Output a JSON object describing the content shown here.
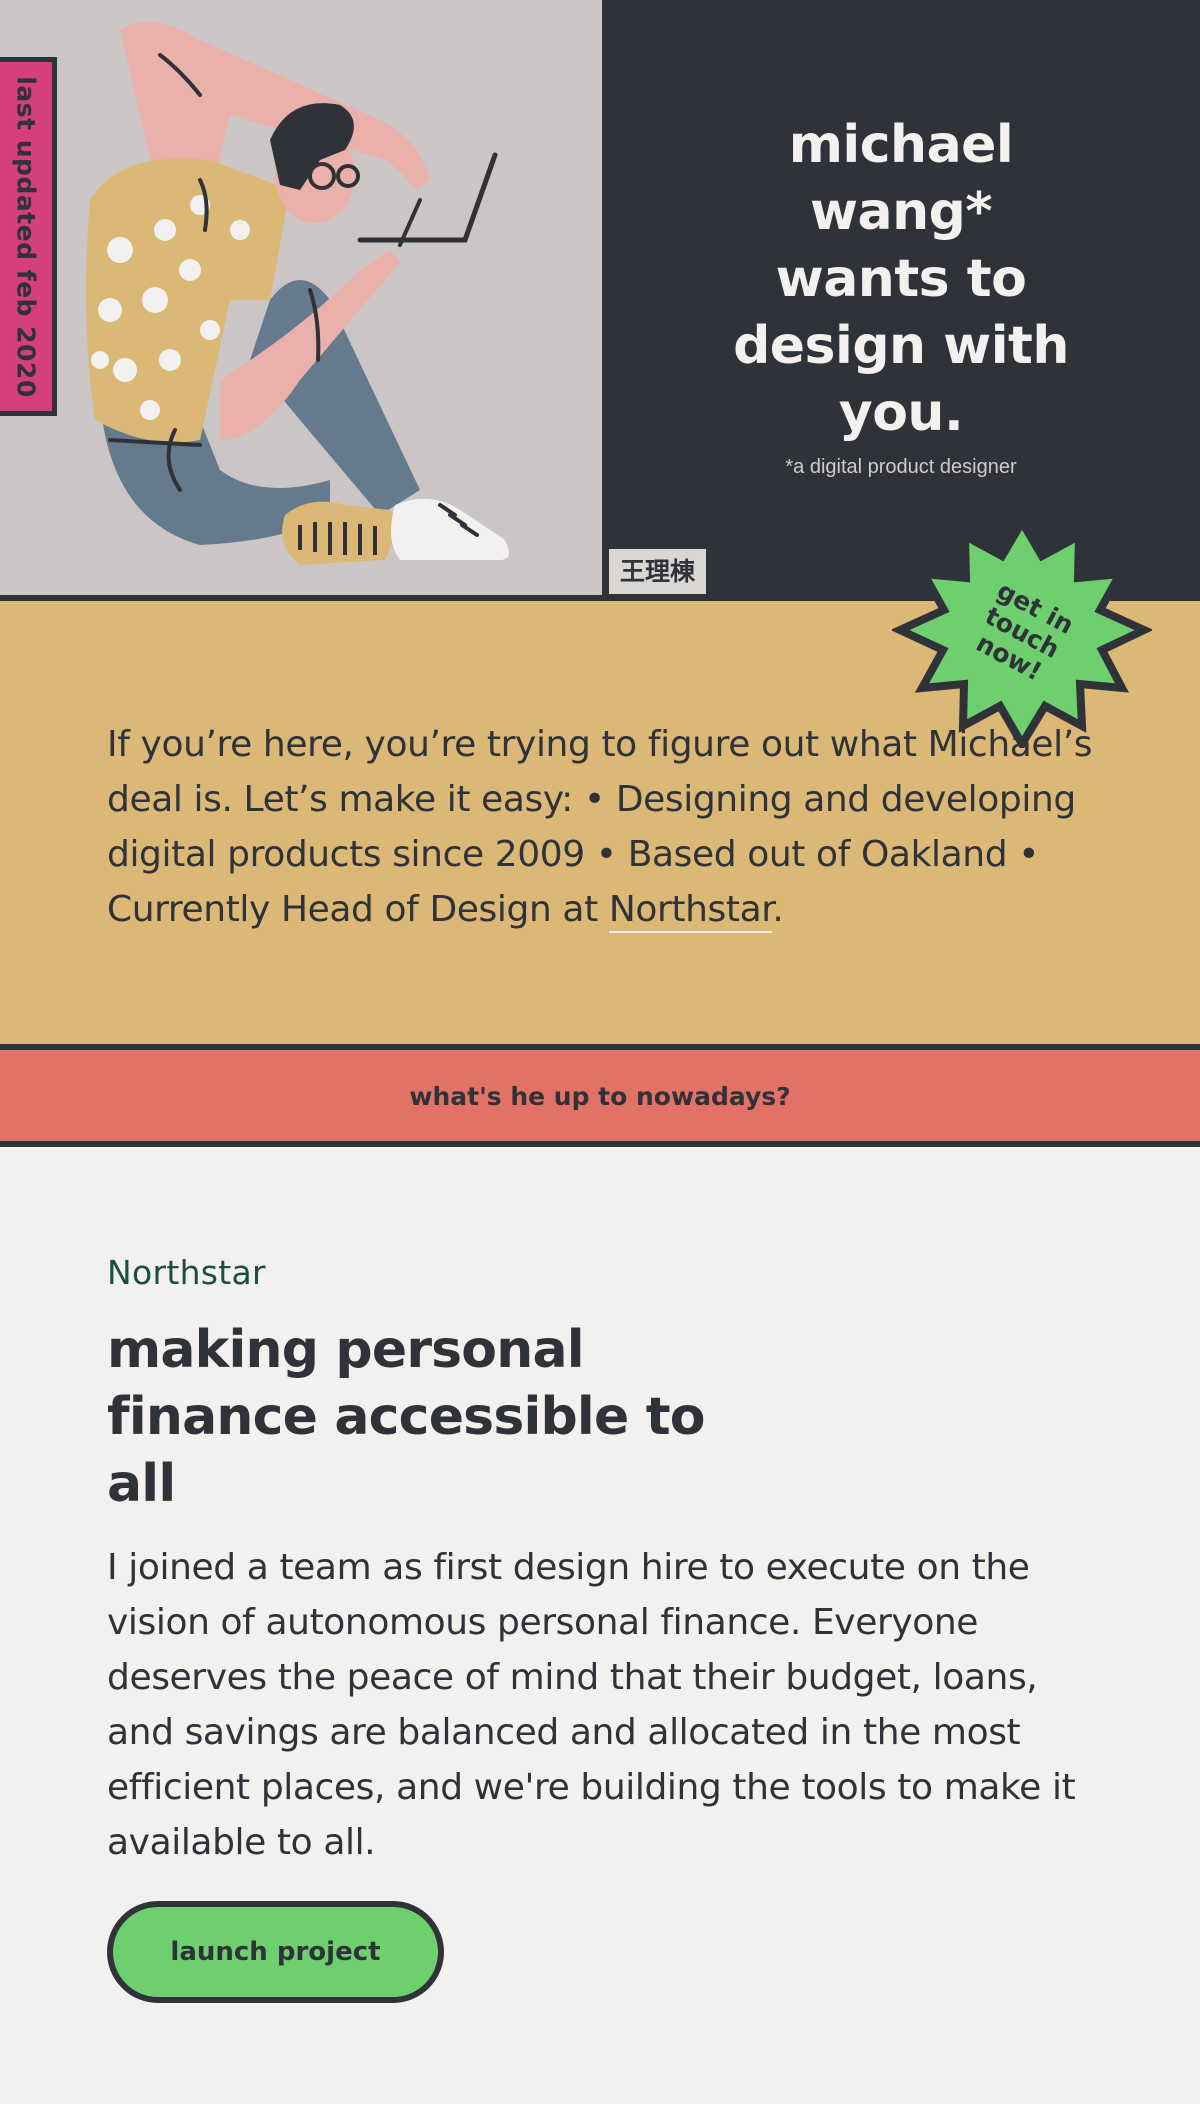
{
  "hero": {
    "updated_badge": "last updated feb 2020",
    "title_lines": [
      "michael",
      "wang*",
      "wants to",
      "design with",
      "you."
    ],
    "subtitle": "*a digital product designer",
    "chinese_name": "王理棟"
  },
  "cta_sticker": {
    "lines": [
      "get in",
      "touch",
      "now!"
    ],
    "color": "#6dcf6d"
  },
  "intro": {
    "text_before_link": "If you’re here, you’re trying to figure out what Michael’s deal is. Let’s make it easy: • Designing and developing digital products since 2009 • Based out of Oakland • Currently Head of Design at ",
    "link_text": "Northstar",
    "text_after_link": "."
  },
  "banner": {
    "label": "what's he up to nowadays?"
  },
  "project": {
    "company": "Northstar",
    "heading": "making personal finance accessible to all",
    "description": "I joined a team as first design hire to execute on the vision of autonomous personal finance. Everyone deserves the peace of mind that their budget, loans, and savings are balanced and allocated in the most efficient places, and we're building the tools to make it available to all.",
    "button_label": "launch project"
  },
  "colors": {
    "dark": "#2f3238",
    "mustard": "#dbb875",
    "coral": "#e27266",
    "green": "#6dcf6d",
    "pink": "#d63f7f",
    "light": "#f2f1ef"
  }
}
